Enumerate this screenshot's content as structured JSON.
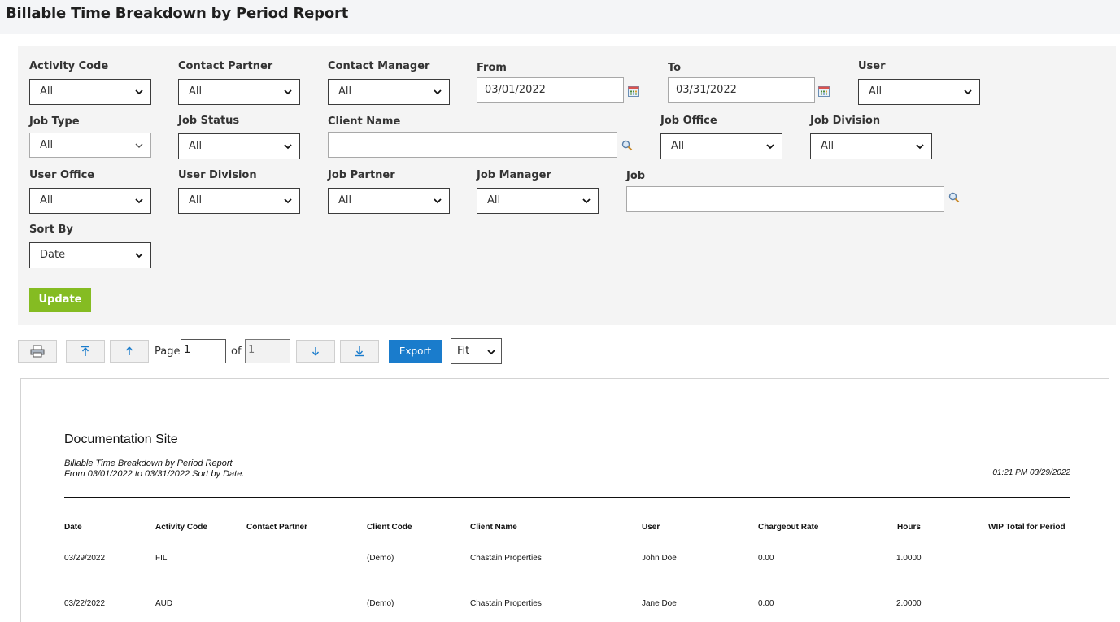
{
  "page": {
    "title": "Billable Time Breakdown by Period Report"
  },
  "filters": {
    "activity_code": {
      "label": "Activity Code",
      "value": "All"
    },
    "contact_partner": {
      "label": "Contact Partner",
      "value": "All"
    },
    "contact_manager": {
      "label": "Contact Manager",
      "value": "All"
    },
    "from": {
      "label": "From",
      "value": "03/01/2022"
    },
    "to": {
      "label": "To",
      "value": "03/31/2022"
    },
    "user": {
      "label": "User",
      "value": "All"
    },
    "job_type": {
      "label": "Job Type",
      "value": "All"
    },
    "job_status": {
      "label": "Job Status",
      "value": "All"
    },
    "client_name": {
      "label": "Client Name",
      "value": ""
    },
    "job_office": {
      "label": "Job Office",
      "value": "All"
    },
    "job_division": {
      "label": "Job Division",
      "value": "All"
    },
    "user_office": {
      "label": "User Office",
      "value": "All"
    },
    "user_division": {
      "label": "User Division",
      "value": "All"
    },
    "job_partner": {
      "label": "Job Partner",
      "value": "All"
    },
    "job_manager": {
      "label": "Job Manager",
      "value": "All"
    },
    "job": {
      "label": "Job",
      "value": ""
    },
    "sort_by": {
      "label": "Sort By",
      "value": "Date"
    },
    "update_label": "Update"
  },
  "toolbar": {
    "page_label": "Page",
    "current_page": "1",
    "of_label": "of",
    "total_pages": "1",
    "export_label": "Export",
    "zoom": "Fit"
  },
  "report": {
    "company": "Documentation Site",
    "title": "Billable Time Breakdown by Period Report",
    "criteria": "From 03/01/2022 to 03/31/2022 Sort by Date.",
    "timestamp": "01:21 PM 03/29/2022",
    "columns": [
      "Date",
      "Activity Code",
      "Contact Partner",
      "Client Code",
      "Client Name",
      "User",
      "Chargeout Rate",
      "Hours",
      "WIP Total for Period"
    ],
    "rows": [
      [
        "03/29/2022",
        "FIL",
        "",
        "(Demo)",
        "Chastain Properties",
        "John Doe",
        "0.00",
        "1.0000",
        ""
      ],
      [
        "03/22/2022",
        "AUD",
        "",
        "(Demo)",
        "Chastain Properties",
        "Jane Doe",
        "0.00",
        "2.0000",
        ""
      ]
    ]
  }
}
